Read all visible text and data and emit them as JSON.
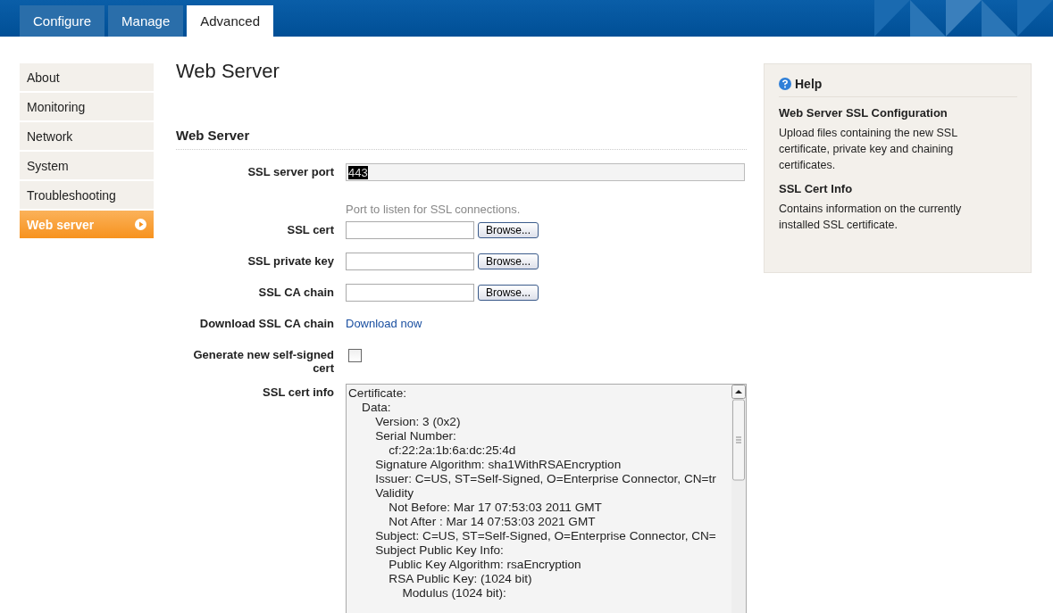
{
  "tabs": [
    {
      "label": "Configure",
      "selected": false
    },
    {
      "label": "Manage",
      "selected": false
    },
    {
      "label": "Advanced",
      "selected": true
    }
  ],
  "sidebar": {
    "items": [
      {
        "label": "About",
        "selected": false
      },
      {
        "label": "Monitoring",
        "selected": false
      },
      {
        "label": "Network",
        "selected": false
      },
      {
        "label": "System",
        "selected": false
      },
      {
        "label": "Troubleshooting",
        "selected": false
      },
      {
        "label": "Web server",
        "selected": true
      }
    ]
  },
  "page_title": "Web Server",
  "section_title": "Web Server",
  "form": [
    {
      "kind": "text",
      "label": "SSL server port",
      "value": "443",
      "hint": "Port to listen for SSL connections."
    },
    {
      "kind": "file",
      "label": "SSL cert",
      "button": "Browse..."
    },
    {
      "kind": "file",
      "label": "SSL private key",
      "button": "Browse..."
    },
    {
      "kind": "file",
      "label": "SSL CA chain",
      "button": "Browse..."
    },
    {
      "kind": "link",
      "label": "Download SSL CA chain",
      "link": "Download now"
    },
    {
      "kind": "checkbox",
      "label": "Generate new self-signed cert",
      "checked": false
    },
    {
      "kind": "textarea",
      "label": "SSL cert info",
      "value": "Certificate:\n    Data:\n        Version: 3 (0x2)\n        Serial Number:\n            cf:22:2a:1b:6a:dc:25:4d\n        Signature Algorithm: sha1WithRSAEncryption\n        Issuer: C=US, ST=Self-Signed, O=Enterprise Connector, CN=tr\n        Validity\n            Not Before: Mar 17 07:53:03 2011 GMT\n            Not After : Mar 14 07:53:03 2021 GMT\n        Subject: C=US, ST=Self-Signed, O=Enterprise Connector, CN=\n        Subject Public Key Info:\n            Public Key Algorithm: rsaEncryption\n            RSA Public Key: (1024 bit)\n                Modulus (1024 bit):"
    }
  ],
  "help": {
    "title": "Help",
    "sections": [
      {
        "heading": "Web Server SSL Configuration",
        "text": "Upload files containing the new SSL certificate, private key and chaining certificates."
      },
      {
        "heading": "SSL Cert Info",
        "text": "Contains information on the currently installed SSL certificate."
      }
    ]
  }
}
